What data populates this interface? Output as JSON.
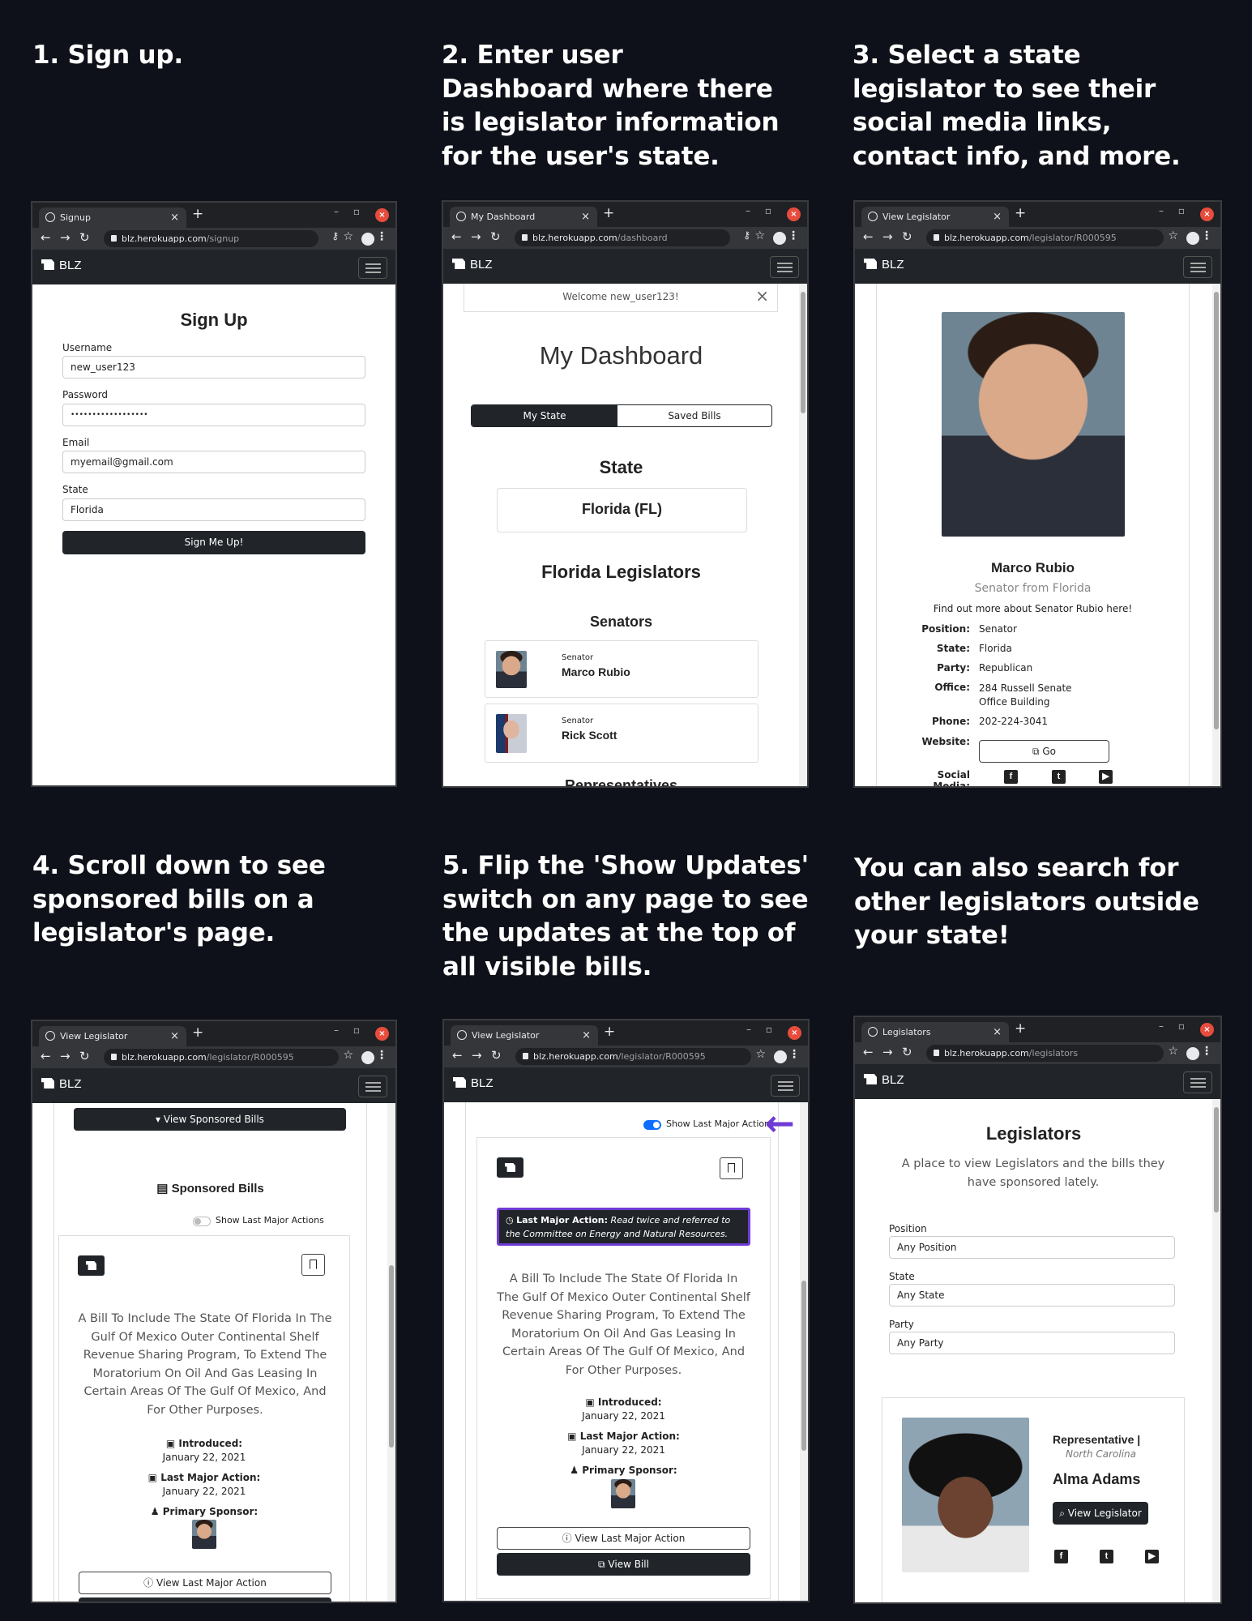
{
  "captions": {
    "c1": "1. Sign up.",
    "c2": "2. Enter user Dashboard where there is legislator information for the user's state.",
    "c3": "3. Select a state legislator to see their social media links, contact info, and more.",
    "c4": "4. Scroll down to see sponsored bills on a legislator's page.",
    "c5": "5. Flip the 'Show Updates' switch on any page to see the updates at the top of all visible bills.",
    "c6": "You can also search for other legislators outside your state!"
  },
  "brand": "BLZ",
  "domain": "blz.herokuapp.com",
  "signup": {
    "tab": "Signup",
    "path": "/signup",
    "title": "Sign Up",
    "username_label": "Username",
    "username_value": "new_user123",
    "password_label": "Password",
    "password_value": "••••••••••••••••••",
    "email_label": "Email",
    "email_value": "myemail@gmail.com",
    "state_label": "State",
    "state_value": "Florida",
    "submit": "Sign Me Up!"
  },
  "dashboard": {
    "tab": "My Dashboard",
    "path": "/dashboard",
    "welcome": "Welcome new_user123!",
    "title": "My Dashboard",
    "tab_state": "My State",
    "tab_saved": "Saved Bills",
    "state_heading": "State",
    "state_value": "Florida (FL)",
    "legislators_heading": "Florida Legislators",
    "senators_heading": "Senators",
    "senators": [
      {
        "role": "Senator",
        "name": "Marco Rubio"
      },
      {
        "role": "Senator",
        "name": "Rick Scott"
      }
    ],
    "representatives_heading": "Representatives"
  },
  "legislator": {
    "tab": "View Legislator",
    "path": "/legislator/R000595",
    "name": "Marco Rubio",
    "subtitle": "Senator from Florida",
    "more": "Find out more about Senator Rubio here!",
    "position_label": "Position:",
    "position": "Senator",
    "state_label": "State:",
    "state": "Florida",
    "party_label": "Party:",
    "party": "Republican",
    "office_label": "Office:",
    "office": "284 Russell Senate Office Building",
    "phone_label": "Phone:",
    "phone": "202-224-3041",
    "website_label": "Website:",
    "website_btn": "Go",
    "social_label": "Social Media:"
  },
  "sponsored": {
    "view_btn": "View Sponsored Bills",
    "heading": "Sponsored Bills",
    "toggle_label": "Show Last Major Actions",
    "bill_title": "A Bill To Include The State Of Florida In The Gulf Of Mexico Outer Continental Shelf Revenue Sharing Program, To Extend The Moratorium On Oil And Gas Leasing In Certain Areas Of The Gulf Of Mexico, And For Other Purposes.",
    "introduced_label": "Introduced:",
    "introduced": "January 22, 2021",
    "last_action_label": "Last Major Action:",
    "last_action_date": "January 22, 2021",
    "sponsor_label": "Primary Sponsor:",
    "view_action_btn": "View Last Major Action",
    "view_bill_btn": "View Bill"
  },
  "updates": {
    "toggle_label": "Show Last Major Actions",
    "action_label": "Last Major Action:",
    "action_text": "Read twice and referred to the Committee on Energy and Natural Resources."
  },
  "search": {
    "tab": "Legislators",
    "path": "/legislators",
    "title": "Legislators",
    "subtitle": "A place to view Legislators and the bills they have sponsored lately.",
    "position_label": "Position",
    "position_value": "Any Position",
    "state_label": "State",
    "state_value": "Any State",
    "party_label": "Party",
    "party_value": "Any Party",
    "result_role": "Representative |",
    "result_state": "North Carolina",
    "result_name": "Alma Adams",
    "result_btn": "View Legislator"
  },
  "social_icons": [
    "facebook-icon",
    "twitter-icon",
    "youtube-icon"
  ]
}
